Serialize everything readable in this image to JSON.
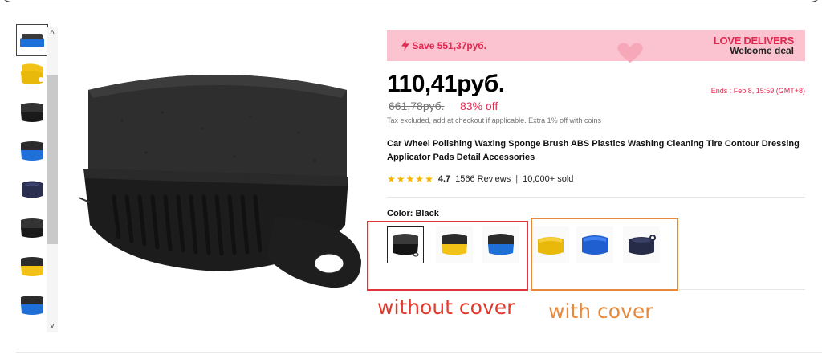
{
  "gallery": {
    "thumbnails": [
      "blue-sponge",
      "yellow-sponge",
      "black-sponge",
      "blue-sponge",
      "navy-sponge",
      "black-sponge",
      "yellow-sponge",
      "blue-sponge"
    ]
  },
  "banner": {
    "save": "Save 551,37руб.",
    "love": "LOVE DELIVERS",
    "welcome": "Welcome deal"
  },
  "price": {
    "current": "110,41руб.",
    "original": "661,78руб.",
    "discount": "83% off",
    "ends": "Ends :  Feb 8, 15:59 (GMT+8)",
    "tax_note": "Tax excluded, add at checkout if applicable. Extra 1% off with coins"
  },
  "product": {
    "title": "Car Wheel Polishing Waxing Sponge Brush ABS Plastics Washing Cleaning Tire Contour Dressing Applicator Pads Detail Accessories"
  },
  "rating": {
    "stars": 4.7,
    "value": "4.7",
    "reviews": "1566 Reviews",
    "sep": "|",
    "sold": "10,000+ sold"
  },
  "color": {
    "label": "Color: ",
    "selected": "Black"
  },
  "annotations": {
    "without_cover": "without cover",
    "with_cover": "with cover"
  },
  "colors": {
    "accent_red": "#e02950",
    "banner_bg": "#fbc3cf",
    "annotation_red": "#e23a2c",
    "annotation_orange": "#e58a3d"
  }
}
